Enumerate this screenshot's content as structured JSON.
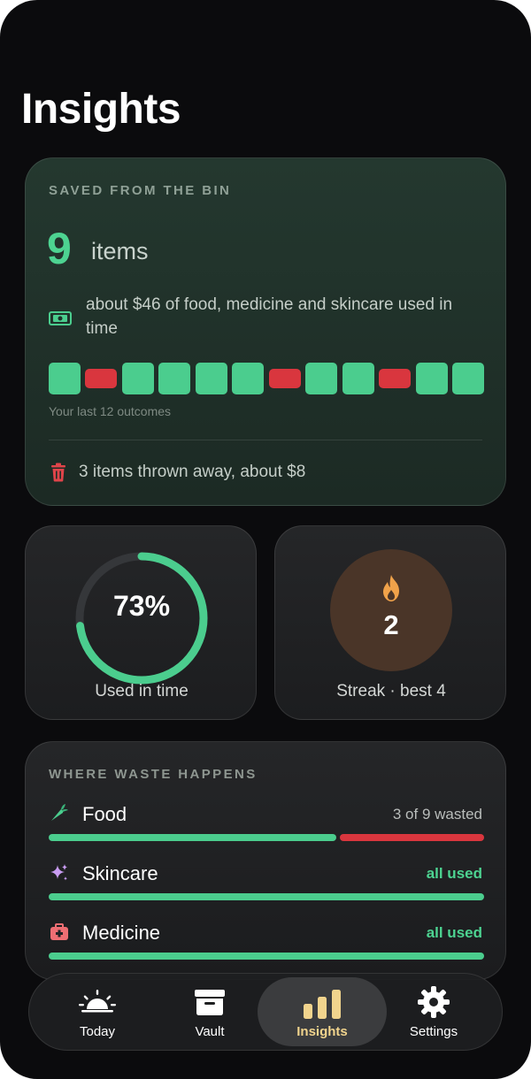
{
  "page": {
    "title": "Insights"
  },
  "saved": {
    "label": "SAVED FROM THE BIN",
    "count": "9",
    "unit": "items",
    "money_text": "about $46 of food, medicine and skincare used in time",
    "outcomes": [
      "saved",
      "wasted",
      "saved",
      "saved",
      "saved",
      "saved",
      "wasted",
      "saved",
      "saved",
      "wasted",
      "saved",
      "saved"
    ],
    "outcomes_label": "Your last 12 outcomes",
    "thrown_text": "3 items thrown away, about $8"
  },
  "used": {
    "percent": 73,
    "value_text": "73%",
    "caption": "Used in time"
  },
  "streak": {
    "value": "2",
    "caption": "Streak · best 4"
  },
  "waste": {
    "label": "WHERE WASTE HAPPENS",
    "categories": [
      {
        "name": "Food",
        "icon": "carrot-icon",
        "status": "3 of 9 wasted",
        "used": 6,
        "wasted": 3
      },
      {
        "name": "Skincare",
        "icon": "sparkles-icon",
        "status": "all used",
        "used": 1,
        "wasted": 0
      },
      {
        "name": "Medicine",
        "icon": "first-aid-kit-icon",
        "status": "all used",
        "used": 1,
        "wasted": 0
      }
    ]
  },
  "tabs": [
    {
      "label": "Today",
      "icon": "sunrise-icon",
      "active": false
    },
    {
      "label": "Vault",
      "icon": "archive-box-icon",
      "active": false
    },
    {
      "label": "Insights",
      "icon": "bar-chart-icon",
      "active": true
    },
    {
      "label": "Settings",
      "icon": "gear-icon",
      "active": false
    }
  ],
  "colors": {
    "accent_green": "#4bcd8e",
    "waste_red": "#d9363e",
    "active_tab": "#f1d48d",
    "streak_orange": "#f0a24a"
  }
}
